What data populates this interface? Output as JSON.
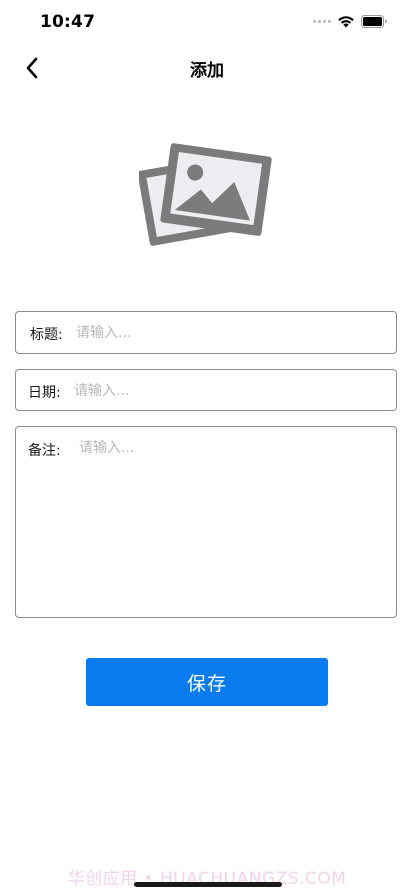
{
  "status_bar": {
    "time": "10:47"
  },
  "nav": {
    "title": "添加",
    "back_icon": "chevron-left-icon"
  },
  "image_picker": {
    "icon": "image-placeholder-icon"
  },
  "form": {
    "title_label": "标题:",
    "title_placeholder": "请输入...",
    "title_value": "",
    "date_label": "日期:",
    "date_placeholder": "请输入...",
    "date_value": "",
    "notes_label": "备注:",
    "notes_placeholder": "请输入...",
    "notes_value": ""
  },
  "save_button": {
    "label": "保存",
    "color": "#0a7cf0"
  },
  "watermark": "华创应用 • HUACHUANGZS.COM"
}
